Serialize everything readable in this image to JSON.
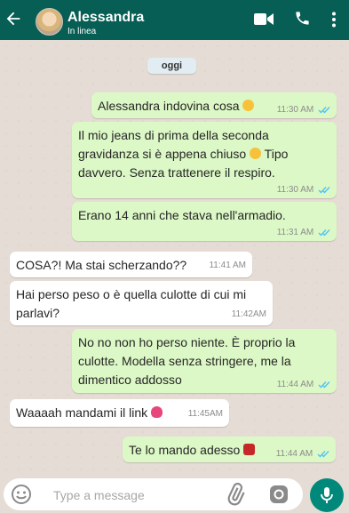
{
  "header": {
    "title": "Alessandra",
    "status": "In linea"
  },
  "chat": {
    "date_label": "oggi",
    "messages": [
      {
        "text": "Alessandra indovina cosa",
        "time": "11:30 AM",
        "direction": "out"
      },
      {
        "line1": "Il mio jeans di prima della seconda",
        "line2": "gravidanza si è appena chiuso",
        "line2b": "Tipo",
        "line3": "davvero. Senza trattenere il respiro.",
        "time": "11:30 AM",
        "direction": "out"
      },
      {
        "text": "Erano 14 anni che stava nell'armadio.",
        "time": "11:31 AM",
        "direction": "out"
      },
      {
        "text": "COSA?! Ma stai scherzando??",
        "time": "11:41 AM",
        "direction": "in"
      },
      {
        "line1": "Hai perso peso o è quella culotte di cui mi",
        "line2": "parlavi?",
        "time": "11:42AM",
        "direction": "in"
      },
      {
        "line1": "No no non ho perso niente. È proprio la",
        "line2": "culotte. Modella senza stringere, me la",
        "line3": "dimentico addosso",
        "time": "11:44 AM",
        "direction": "out"
      },
      {
        "text": "Waaaah mandami il link",
        "time": "11:45AM",
        "direction": "in"
      },
      {
        "text": "Te lo mando adesso",
        "time": "11:44 AM",
        "direction": "out"
      }
    ]
  },
  "composer": {
    "placeholder": "Type a message"
  },
  "colors": {
    "header_bg": "#075e54",
    "outgoing_bubble": "#dcf8c6",
    "incoming_bubble": "#ffffff",
    "read_ticks": "#4fc3f7",
    "mic_button": "#00897b"
  },
  "icons": [
    "back-arrow-icon",
    "video-call-icon",
    "phone-icon",
    "more-options-icon",
    "emoji-icon",
    "attach-icon",
    "camera-icon",
    "mic-icon"
  ]
}
